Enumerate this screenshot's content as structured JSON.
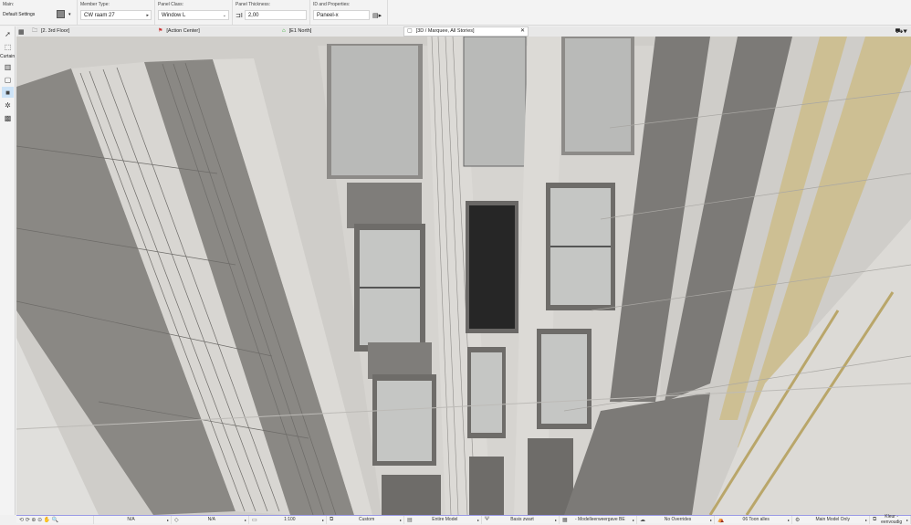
{
  "infobox": {
    "main": {
      "label": "Main:",
      "value": "Default Settings"
    },
    "member_type": {
      "label": "Member Type:",
      "value": "CW raam 27"
    },
    "panel_class": {
      "label": "Panel Class:",
      "value": "Window L"
    },
    "panel_thickness": {
      "label": "Panel Thickness:",
      "value": "2,00"
    },
    "id_properties": {
      "label": "ID and Properties:",
      "value": "Paneel-x"
    }
  },
  "tabs": [
    {
      "label": "[2. 3rd Floor]",
      "icon": "floor-plan-icon"
    },
    {
      "label": "[Action Center]",
      "icon": "action-center-icon"
    },
    {
      "label": "[E1 North]",
      "icon": "elevation-icon"
    },
    {
      "label": "[3D / Marquee, All Stories]",
      "icon": "3d-icon",
      "active": true
    }
  ],
  "toolbox": {
    "curtain_label": "Curtain"
  },
  "status": {
    "layer_na1": "N/A",
    "layer_na2": "N/A",
    "scale": "1:100",
    "view_custom": "Custom",
    "model": "Entire Model",
    "pen_set": "Basis zwart",
    "model_view": "- Modelleerweergave BE",
    "overrides": "No Overrides",
    "renovation": "06 Toon alles",
    "structure": "Main Model Only",
    "color": "Kleur - eenvoudig"
  },
  "colors": {
    "accent": "#9a9ae6",
    "selected_tool": "#cde3f7",
    "dark_panel": "#7a7875",
    "facade": "#d2d0cc"
  }
}
